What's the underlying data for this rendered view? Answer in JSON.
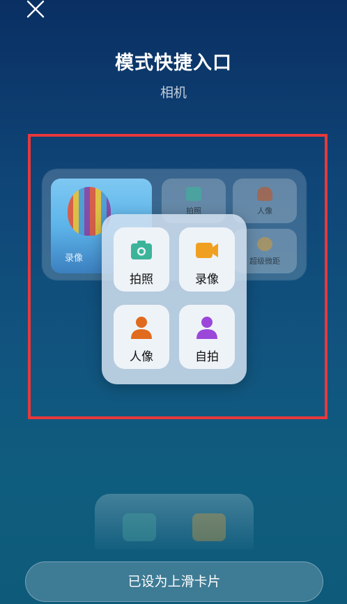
{
  "header": {
    "close_icon": "close-icon",
    "title": "模式快捷入口",
    "subtitle": "相机"
  },
  "background_card": {
    "photo_label": "录像",
    "tiles": [
      {
        "label": "拍照",
        "icon": "camera-icon"
      },
      {
        "label": "人像",
        "icon": "person-icon"
      },
      {
        "label": "超级微距",
        "icon": "flower-icon"
      }
    ]
  },
  "popup": {
    "tiles": [
      {
        "label": "拍照",
        "icon": "camera-icon",
        "color": "#3cb49a"
      },
      {
        "label": "录像",
        "icon": "video-camera-icon",
        "color": "#f0a020"
      },
      {
        "label": "人像",
        "icon": "person-icon",
        "color": "#e06a1e"
      },
      {
        "label": "自拍",
        "icon": "selfie-person-icon",
        "color": "#9b47d9"
      }
    ]
  },
  "footer": {
    "button_label": "已设为上滑卡片"
  },
  "colors": {
    "highlight_border": "#e8383b"
  }
}
